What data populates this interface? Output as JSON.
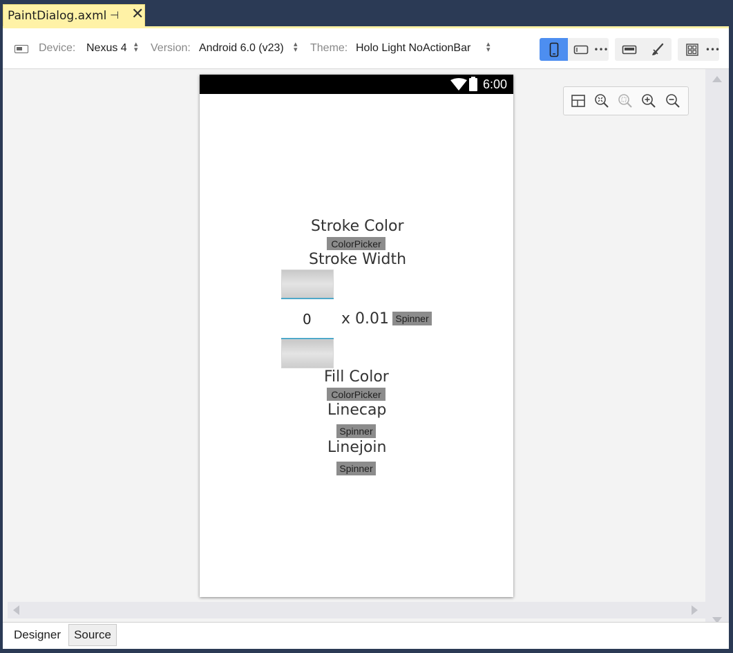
{
  "document_tab": {
    "title": "PaintDialog.axml"
  },
  "toolbar": {
    "device_label": "Device:",
    "device_value": "Nexus 4",
    "version_label": "Version:",
    "version_value": "Android 6.0 (v23)",
    "theme_label": "Theme:",
    "theme_value": "Holo Light NoActionBar"
  },
  "colors": {
    "accent": "#4d8ef0",
    "document_tab": "#fff2a6",
    "frame": "#2b3a55",
    "placeholder_widget": "#8c8c8c",
    "numberpicker_line": "#4ea8c9"
  },
  "icons": {
    "device": "device-icon",
    "portrait": "portrait-phone-icon",
    "landscape": "landscape-phone-icon",
    "more": "more-icon",
    "action_bar": "action-bar-icon",
    "theme_brush": "brush-icon",
    "layout": "layout-grid-icon",
    "pin": "pin-icon",
    "close": "close-icon"
  },
  "phone": {
    "status_time": "6:00",
    "stroke_color_label": "Stroke Color",
    "stroke_color_widget": "ColorPicker",
    "stroke_width_label": "Stroke Width",
    "stroke_width_value": "0",
    "stroke_width_multiplier": "x 0.01",
    "stroke_width_spinner": "Spinner",
    "fill_color_label": "Fill Color",
    "fill_color_widget": "ColorPicker",
    "linecap_label": "Linecap",
    "linecap_spinner": "Spinner",
    "linejoin_label": "Linejoin",
    "linejoin_spinner": "Spinner"
  },
  "bottom_tabs": [
    {
      "label": "Designer",
      "active": true
    },
    {
      "label": "Source",
      "active": false
    }
  ]
}
